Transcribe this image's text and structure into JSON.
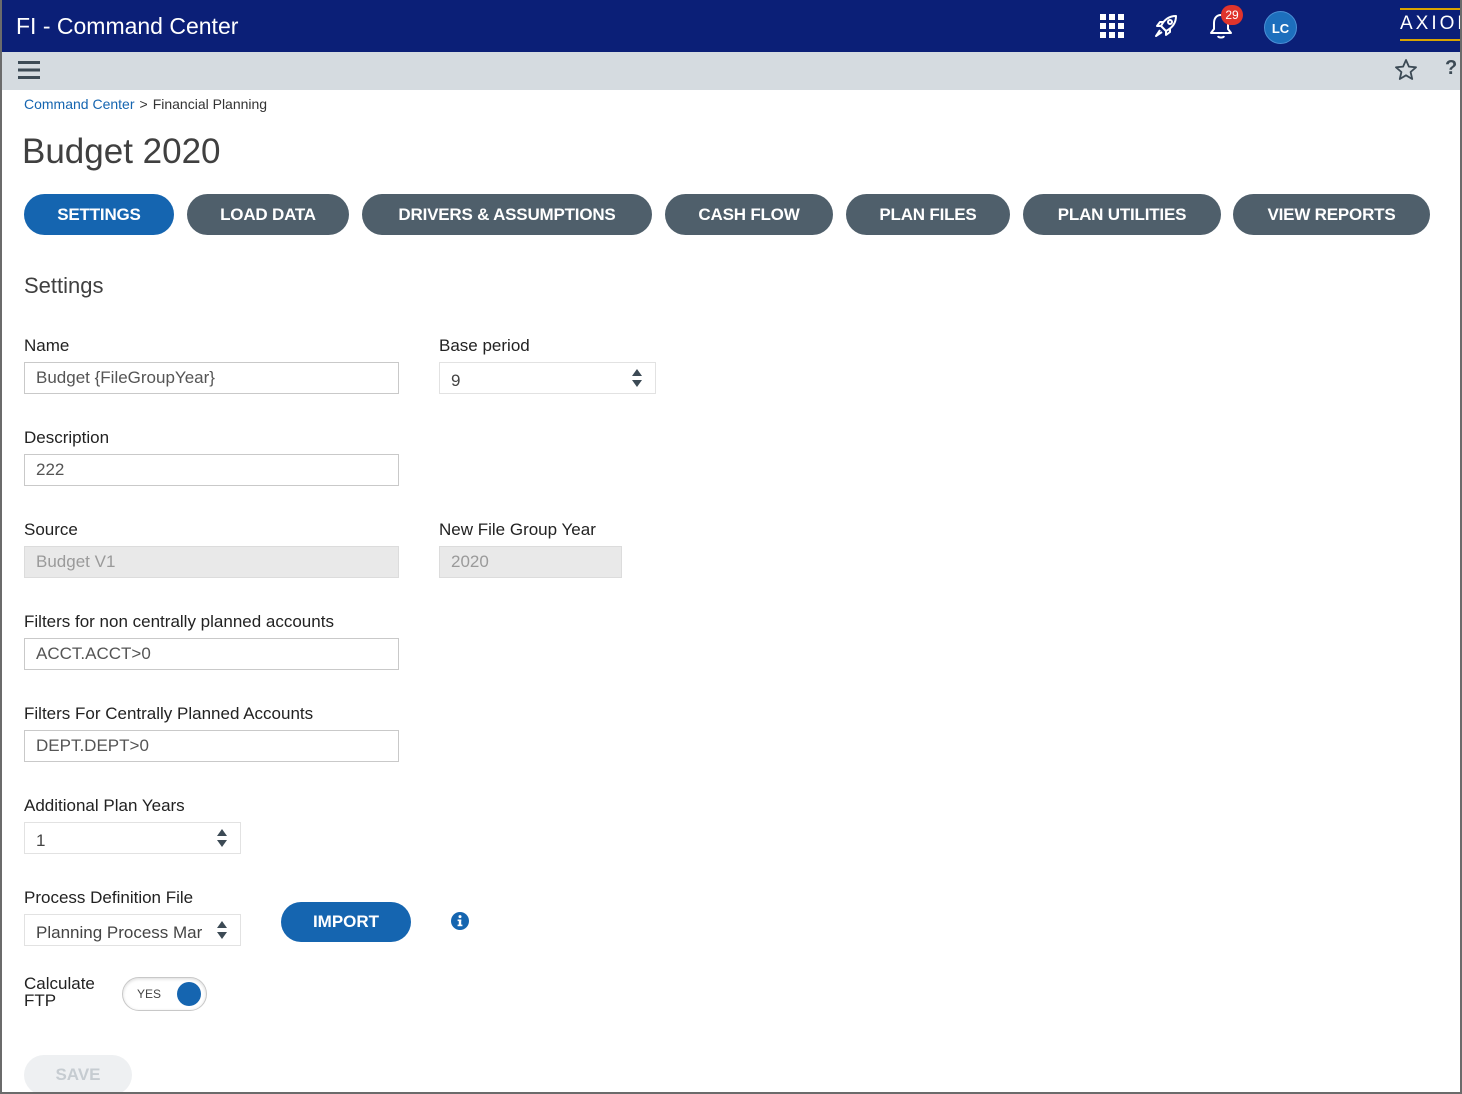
{
  "header": {
    "app_title": "FI - Command Center",
    "notification_count": "29",
    "avatar_initials": "LC",
    "brand": "AXIOM",
    "icons": [
      "apps-grid-icon",
      "rocket-icon",
      "bell-icon"
    ],
    "colors": {
      "bar": "#0b1f77",
      "badge": "#e0342c",
      "accent": "#1565b0"
    }
  },
  "subbar": {
    "icons": [
      "hamburger-menu-icon",
      "star-icon",
      "help-icon"
    ],
    "help_glyph": "?"
  },
  "breadcrumb": {
    "root": "Command Center",
    "separator": ">",
    "current": "Financial Planning"
  },
  "page": {
    "title": "Budget 2020"
  },
  "tabs": [
    {
      "label": "SETTINGS",
      "active": true
    },
    {
      "label": "LOAD DATA",
      "active": false
    },
    {
      "label": "DRIVERS & ASSUMPTIONS",
      "active": false
    },
    {
      "label": "CASH FLOW",
      "active": false
    },
    {
      "label": "PLAN FILES",
      "active": false
    },
    {
      "label": "PLAN UTILITIES",
      "active": false
    },
    {
      "label": "VIEW REPORTS",
      "active": false
    }
  ],
  "settings": {
    "section_title": "Settings",
    "name": {
      "label": "Name",
      "value": "Budget {FileGroupYear}"
    },
    "base_period": {
      "label": "Base period",
      "value": "9"
    },
    "description": {
      "label": "Description",
      "value": "222"
    },
    "source": {
      "label": "Source",
      "value": "Budget V1"
    },
    "new_file_group_year": {
      "label": "New File Group Year",
      "value": "2020"
    },
    "filters_non_central": {
      "label": "Filters for non centrally planned accounts",
      "value": "ACCT.ACCT>0"
    },
    "filters_central": {
      "label": "Filters For Centrally Planned Accounts",
      "value": "DEPT.DEPT>0"
    },
    "additional_plan_years": {
      "label": "Additional Plan Years",
      "value": "1"
    },
    "process_definition_file": {
      "label": "Process Definition File",
      "value": "Planning Process Mar"
    },
    "import_label": "IMPORT",
    "calculate_ftp": {
      "label_line1": "Calculate",
      "label_line2": "FTP",
      "toggle_text": "YES",
      "on": true
    },
    "save_label": "SAVE"
  }
}
